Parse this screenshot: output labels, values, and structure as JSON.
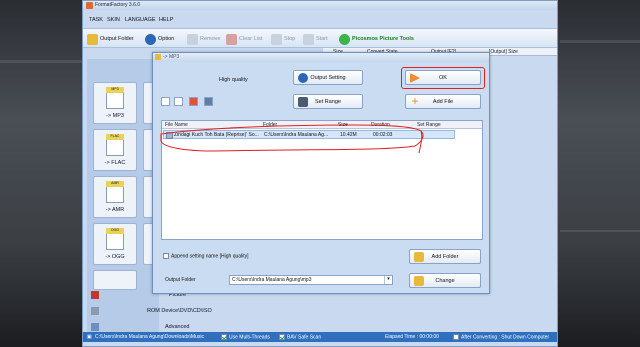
{
  "app": {
    "title": "FormatFactory 3.6.0"
  },
  "menu": [
    "TASK",
    "SKIN",
    "LANGUAGE",
    "HELP"
  ],
  "toolbar": {
    "output_folder": "Output Folder",
    "option": "Option",
    "remove": "Remove",
    "clear_list": "Clear List",
    "stop": "Stop",
    "start": "Start",
    "picture_tools": "Picosmos Picture Tools"
  },
  "main_columns": [
    "Size",
    "Convert State",
    "Output [F2]",
    "[Output] Size"
  ],
  "sidebar": {
    "formats": [
      "-> MP3",
      "-> FLAC",
      "-> AMR",
      "-> OGG"
    ],
    "format_tags": [
      "MP3",
      "FLAC",
      "AMR",
      "OGG"
    ],
    "rows": [
      "Picture",
      "ROM Device\\DVD\\CD\\ISO",
      "Advanced"
    ]
  },
  "dialog": {
    "title": "-> MP3",
    "quality": "High quality",
    "output_setting": "Output Setting",
    "ok": "OK",
    "set_range": "Set Range",
    "add_file": "Add File",
    "columns": [
      "File Name",
      "Folder",
      "Size",
      "Duration",
      "Set Range"
    ],
    "file": {
      "name": "Zindagi Kuch Toh Bata (Reprise)' So...",
      "folder": "C:\\Users\\Indra Maulana Ag...",
      "size": "10.42M",
      "duration": "00:02:03",
      "range": ""
    },
    "append_label": "Append setting name [High quality]",
    "add_folder": "Add Folder",
    "output_folder_label": "Output Folder",
    "output_folder_value": "C:\\Users\\Indra Maulana Agung\\mp3",
    "change": "Change"
  },
  "statusbar": {
    "path": "C:\\Users\\Indra Maulana Agung\\Downloads\\Music",
    "multi_threads": "Use Multi-Threads",
    "safe_scan": "BAV Safe Scan",
    "elapsed": "Elapsed Time : 00:00:00",
    "after": "After Converting : Shut Down Computer"
  },
  "colors": {
    "annotation_red": "#e02020",
    "status_blue": "#2f6fbd"
  }
}
